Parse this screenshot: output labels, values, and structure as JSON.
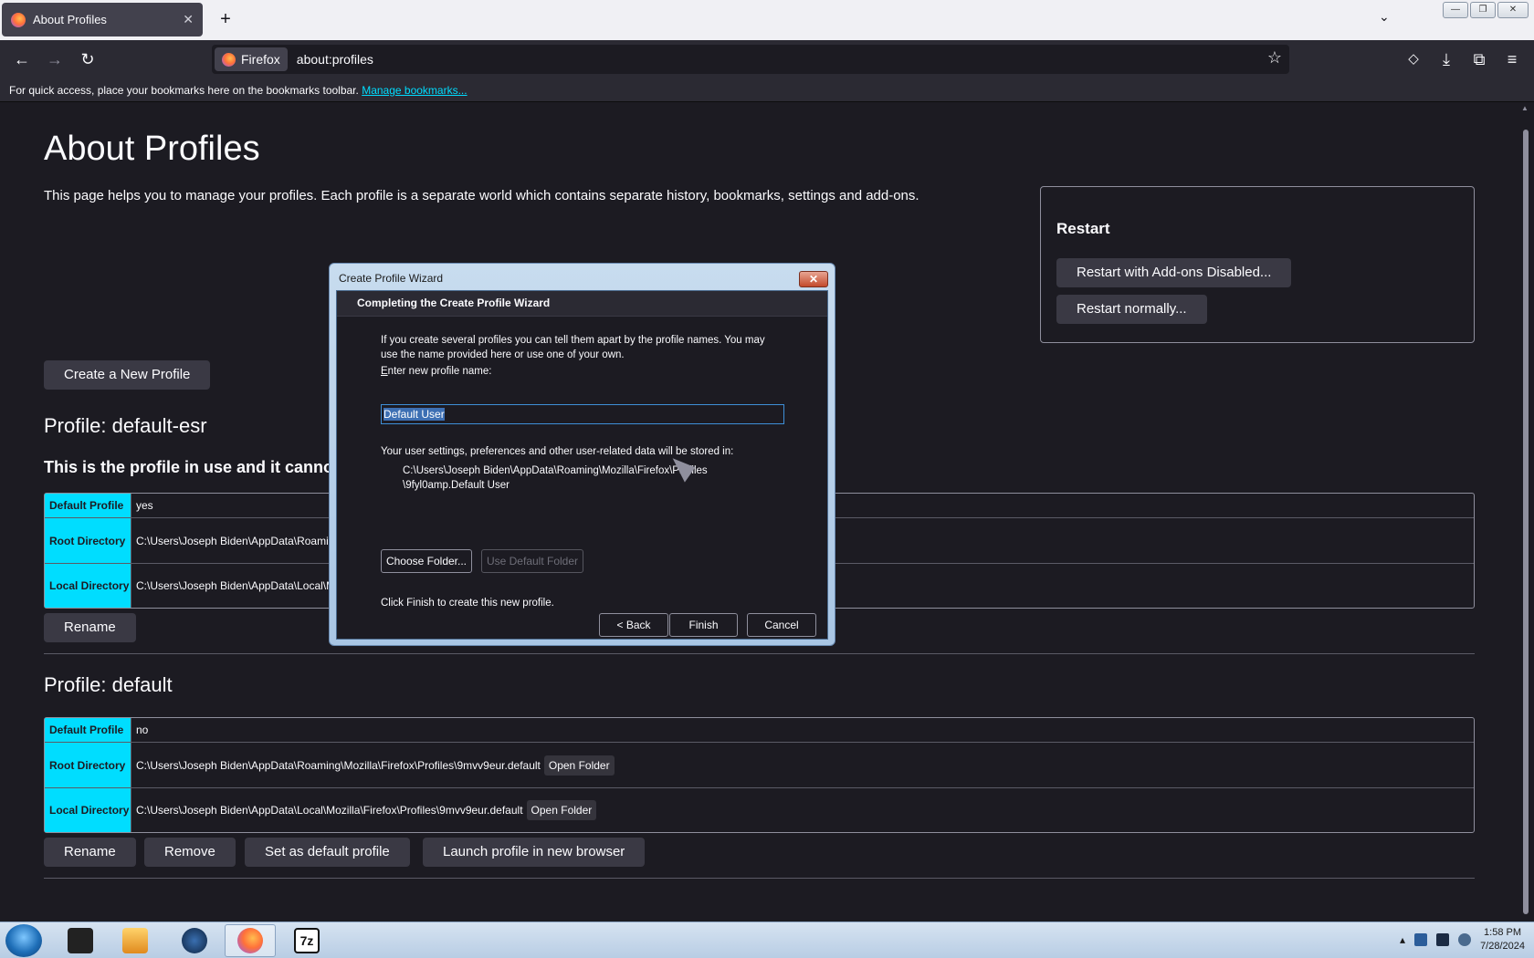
{
  "tab": {
    "title": "About Profiles",
    "close": "✕"
  },
  "newtab": "+",
  "tablist": "⌄",
  "window": {
    "minimize": "—",
    "maximize": "❐",
    "close": "✕"
  },
  "nav": {
    "back": "←",
    "forward": "→",
    "reload": "↻",
    "identity": "Firefox",
    "url": "about:profiles",
    "star": "☆",
    "pocket": "◇",
    "downloads": "⤓",
    "extensions": "⧉",
    "menu": "≡"
  },
  "bookmarks_bar": {
    "text": "For quick access, place your bookmarks here on the bookmarks toolbar.",
    "link": "Manage bookmarks..."
  },
  "page": {
    "title": "About Profiles",
    "description": "This page helps you to manage your profiles. Each profile is a separate world which contains separate history, bookmarks, settings and add-ons.",
    "create_button": "Create a New Profile"
  },
  "restart": {
    "title": "Restart",
    "addons_disabled": "Restart with Add-ons Disabled...",
    "normally": "Restart normally..."
  },
  "profiles": [
    {
      "heading": "Profile: default-esr",
      "in_use": "This is the profile in use and it cannot",
      "rows": [
        {
          "label": "Default Profile",
          "value": "yes"
        },
        {
          "label": "Root Directory",
          "value": "C:\\Users\\Joseph Biden\\AppData\\Roamin"
        },
        {
          "label": "Local Directory",
          "value": "C:\\Users\\Joseph Biden\\AppData\\Local\\M"
        }
      ],
      "rename": "Rename"
    },
    {
      "heading": "Profile: default",
      "rows": [
        {
          "label": "Default Profile",
          "value": "no"
        },
        {
          "label": "Root Directory",
          "value": "C:\\Users\\Joseph Biden\\AppData\\Roaming\\Mozilla\\Firefox\\Profiles\\9mvv9eur.default",
          "open": "Open Folder"
        },
        {
          "label": "Local Directory",
          "value": "C:\\Users\\Joseph Biden\\AppData\\Local\\Mozilla\\Firefox\\Profiles\\9mvv9eur.default",
          "open": "Open Folder"
        }
      ],
      "rename": "Rename",
      "remove": "Remove",
      "set_default": "Set as default profile",
      "launch": "Launch profile in new browser"
    }
  ],
  "dialog": {
    "title": "Create Profile Wizard",
    "close": "✕",
    "header": "Completing the Create Profile Wizard",
    "intro": "If you create several profiles you can tell them apart by the profile names. You may use the name provided here or use one of your own.",
    "name_label": "Enter new profile name:",
    "name_value": "Default User",
    "storage_text": "Your user settings, preferences and other user-related data will be stored in:",
    "path_line1": "C:\\Users\\Joseph Biden\\AppData\\Roaming\\Mozilla\\Firefox\\Profiles",
    "path_line2": "\\9fyl0amp.Default User",
    "choose_folder": "Choose Folder...",
    "use_default_folder": "Use Default Folder",
    "finish_text": "Click Finish to create this new profile.",
    "back": "< Back",
    "finish": "Finish",
    "cancel": "Cancel"
  },
  "taskbar": {
    "items": [
      "terminal",
      "media-player",
      "globe",
      "firefox",
      "7zip"
    ],
    "seven_zip_label": "7z",
    "clock_time": "1:58 PM",
    "clock_date": "7/28/2024",
    "tray_arrow": "▴"
  }
}
